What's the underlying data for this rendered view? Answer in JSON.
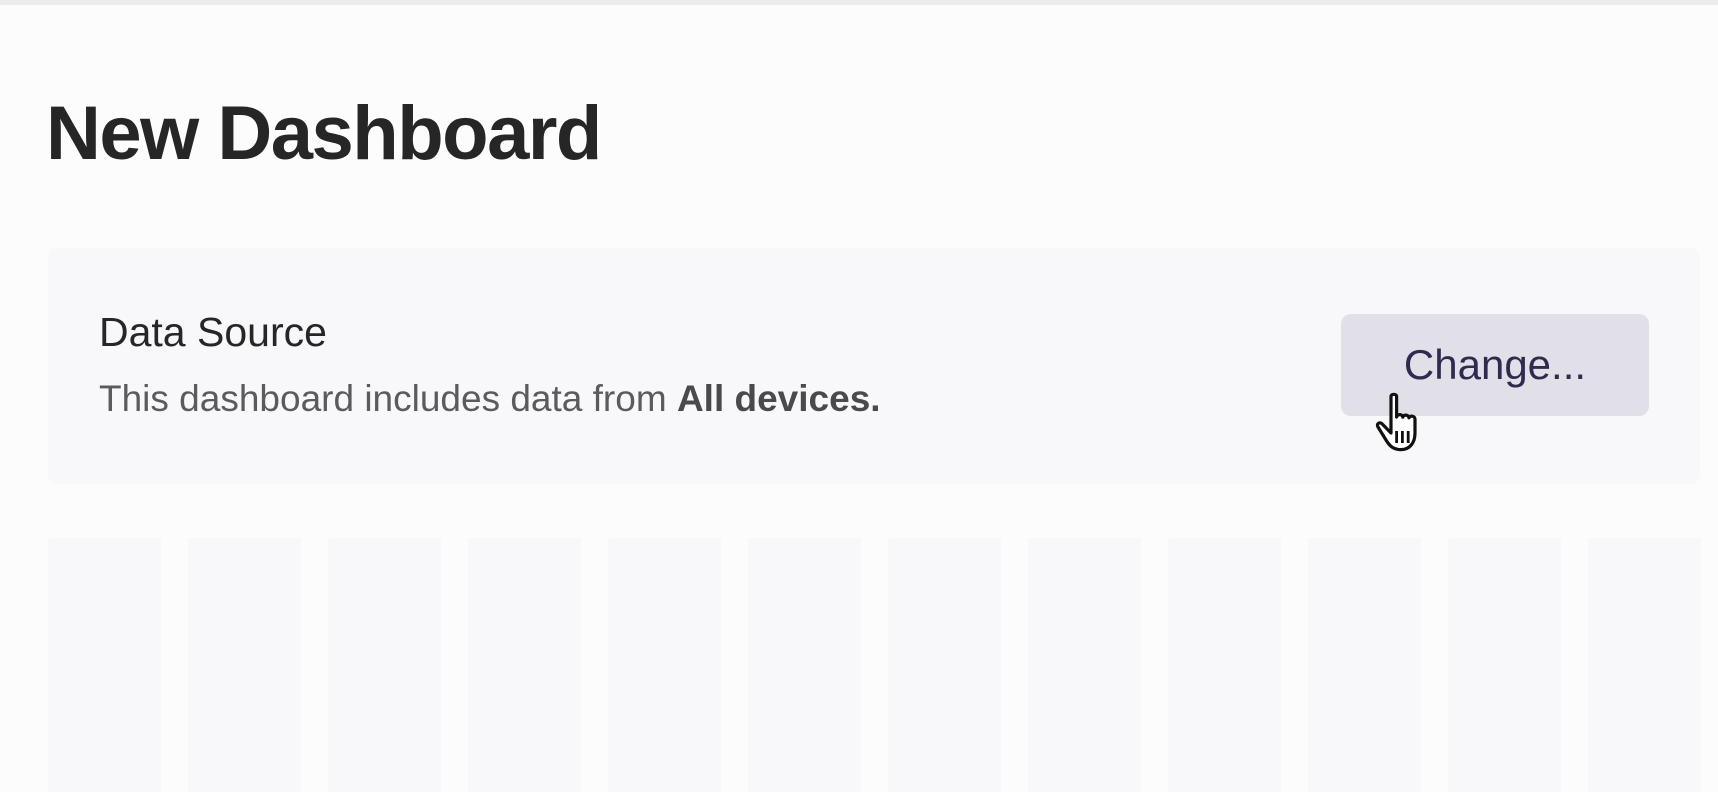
{
  "page": {
    "title": "New Dashboard"
  },
  "data_source": {
    "heading": "Data Source",
    "description_prefix": "This dashboard includes data from ",
    "description_value": "All devices.",
    "change_button_label": "Change..."
  },
  "cursor": {
    "icon": "hand-pointer-icon"
  },
  "colors": {
    "background": "#fcfcfd",
    "card": "#f8f7fa",
    "button_bg": "#e1dfe8",
    "button_text": "#2f2b4e",
    "title": "#262626"
  }
}
